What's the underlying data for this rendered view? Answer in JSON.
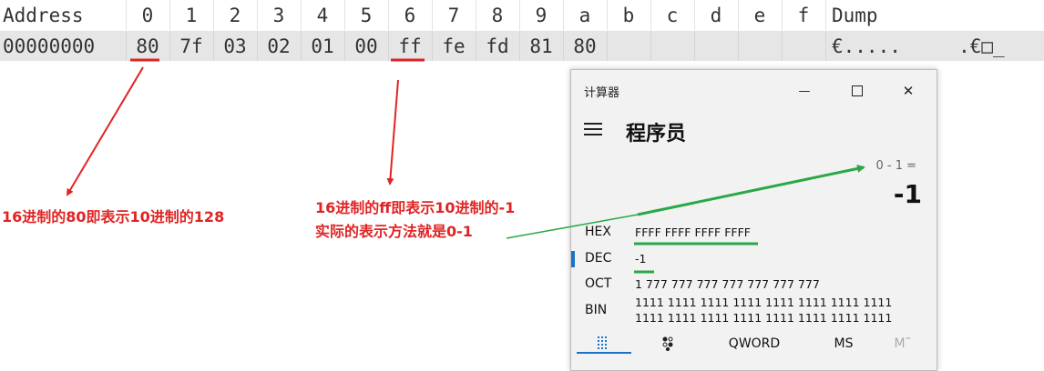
{
  "hex_view": {
    "headers": [
      "Address",
      "0",
      "1",
      "2",
      "3",
      "4",
      "5",
      "6",
      "7",
      "8",
      "9",
      "a",
      "b",
      "c",
      "d",
      "e",
      "f",
      "Dump"
    ],
    "row": {
      "address": "00000000",
      "bytes": [
        "80",
        "7f",
        "03",
        "02",
        "01",
        "00",
        "ff",
        "fe",
        "fd",
        "81",
        "80",
        "",
        "",
        "",
        "",
        ""
      ],
      "dump": "€.....     .€□_"
    }
  },
  "annotations": {
    "note_80": "16进制的80即表示10进制的128",
    "note_ff_line1": "16进制的ff即表示10进制的-1",
    "note_ff_line2": "实际的表示方法就是0-1",
    "red": "#e02424",
    "green": "#2aa845"
  },
  "calculator": {
    "window_title": "计算器",
    "mode_title": "程序员",
    "expression": "0 - 1 =",
    "result": "-1",
    "minimize_glyph": "—",
    "maximize_glyph": "☐",
    "close_glyph": "✕",
    "radix": [
      {
        "label": "HEX",
        "value": "FFFF FFFF FFFF FFFF"
      },
      {
        "label": "DEC",
        "value": "-1"
      },
      {
        "label": "OCT",
        "value": "1 777 777 777 777 777 777 777"
      },
      {
        "label": "BIN",
        "value_line1": "1111 1111 1111 1111 1111 1111 1111 1111",
        "value_line2": "1111 1111 1111 1111 1111 1111 1111 1111"
      }
    ],
    "bottom_tabs": {
      "word_size": "QWORD",
      "ms": "MS",
      "mplus": "M˜"
    },
    "accent": "#1a73c7"
  }
}
